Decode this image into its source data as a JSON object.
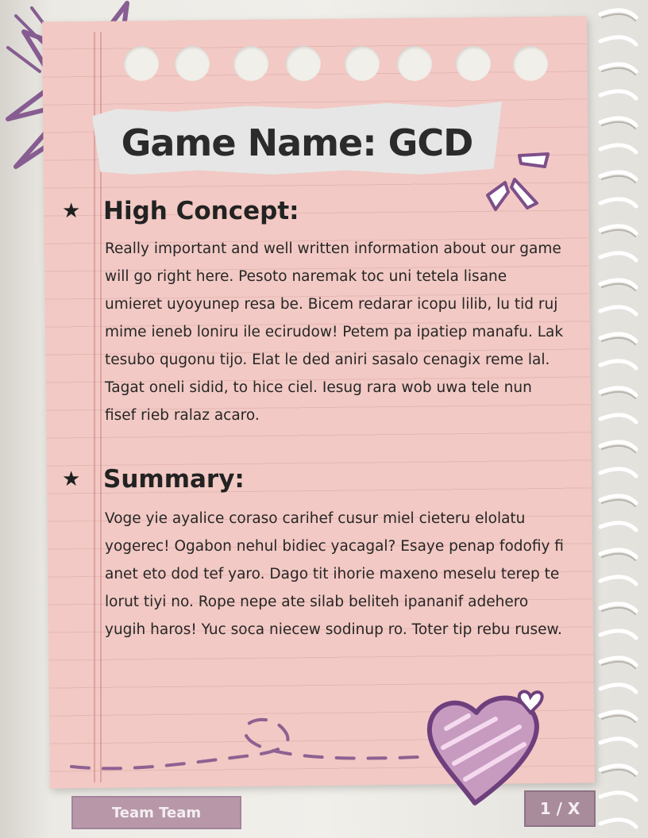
{
  "document": {
    "title": "Game Name: GCD",
    "sections": [
      {
        "heading": "High Concept:",
        "body": "Really important and well written information about our game will go right here. Pesoto naremak toc uni tetela lisane umieret uyoyunep resa be. Bicem redarar icopu lilib, lu tid ruj mime ieneb loniru ile ecirudow! Petem pa ipatiep manafu. Lak tesubo qugonu tijo. Elat le ded aniri sasalo cenagix reme lal. Tagat oneli sidid, to hice ciel. Iesug rara wob uwa tele nun fisef rieb ralaz acaro."
      },
      {
        "heading": "Summary:",
        "body": "Voge yie ayalice coraso carihef cusur miel cieteru elolatu yogerec! Ogabon nehul bidiec yacagal? Esaye penap fodofiy fi anet eto dod tef yaro. Dago tit ihorie maxeno meselu terep te lorut tiyi no. Rope nepe ate silab beliteh ipananif adehero yugih haros! Yuc soca niecew sodinup ro. Toter tip rebu rusew."
      }
    ]
  },
  "footer": {
    "team_label": "Team Team",
    "page_label": "1 / X"
  },
  "colors": {
    "paper": "#f2c9c4",
    "accent_purple": "#7d4f8a",
    "text": "#262626"
  },
  "icons": {
    "bullet": "star-icon",
    "decor_star": "scribble-star-icon",
    "decor_heart": "heart-icon"
  }
}
